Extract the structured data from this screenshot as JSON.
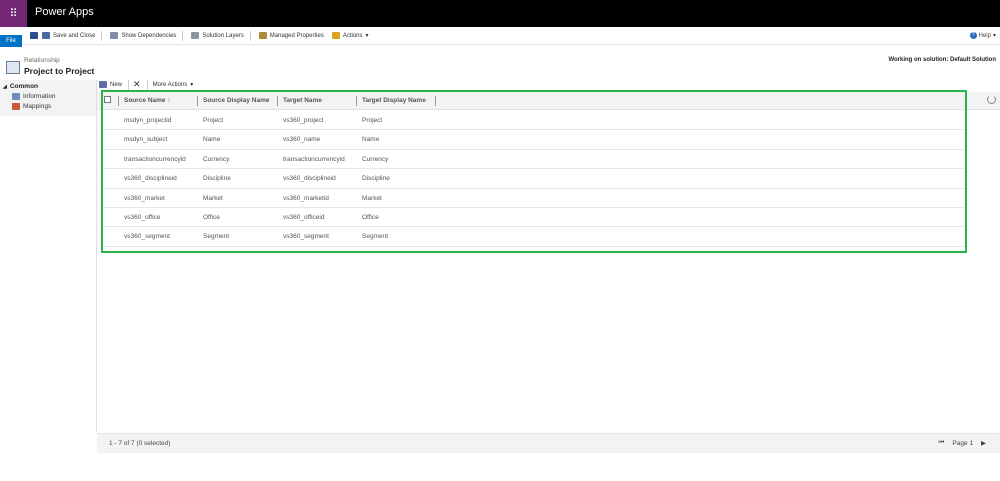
{
  "app": {
    "title": "Power Apps"
  },
  "ribbon": {
    "file": "File",
    "save_and_close": "Save and Close",
    "show_dependencies": "Show Dependencies",
    "solution_layers": "Solution Layers",
    "managed_properties": "Managed Properties",
    "actions": "Actions",
    "help": "Help"
  },
  "header": {
    "entity_type": "Relationship",
    "title": "Project to Project",
    "working_on": "Working on solution: Default Solution"
  },
  "nav": {
    "group": "Common",
    "items": [
      {
        "label": "Information",
        "icon": "information-icon"
      },
      {
        "label": "Mappings",
        "icon": "mappings-icon"
      }
    ]
  },
  "toolbar": {
    "new": "New",
    "more_actions": "More Actions"
  },
  "grid": {
    "columns": [
      "Source Name ↑",
      "Source Display Name",
      "Target Name",
      "Target Display Name"
    ],
    "sort": {
      "column": "Source Name",
      "direction": "ascending"
    },
    "rows": [
      [
        "msdyn_projectid",
        "Project",
        "vs360_project",
        "Project"
      ],
      [
        "msdyn_subject",
        "Name",
        "vs360_name",
        "Name"
      ],
      [
        "transactioncurrencyid",
        "Currency",
        "transactioncurrencyid",
        "Currency"
      ],
      [
        "vs360_disciplineid",
        "Discipline",
        "vs360_disciplineid",
        "Discipline"
      ],
      [
        "vs360_market",
        "Market",
        "vs360_marketid",
        "Market"
      ],
      [
        "vs360_office",
        "Office",
        "vs360_officeid",
        "Office"
      ],
      [
        "vs360_segment",
        "Segment",
        "vs360_segment",
        "Segment"
      ]
    ],
    "highlight_color": "#2bb24c"
  },
  "footer": {
    "count": "1 - 7 of 7 (0 selected)",
    "page": "Page 1"
  },
  "colors": {
    "brand": "#742774",
    "file_button": "#0072c6"
  }
}
